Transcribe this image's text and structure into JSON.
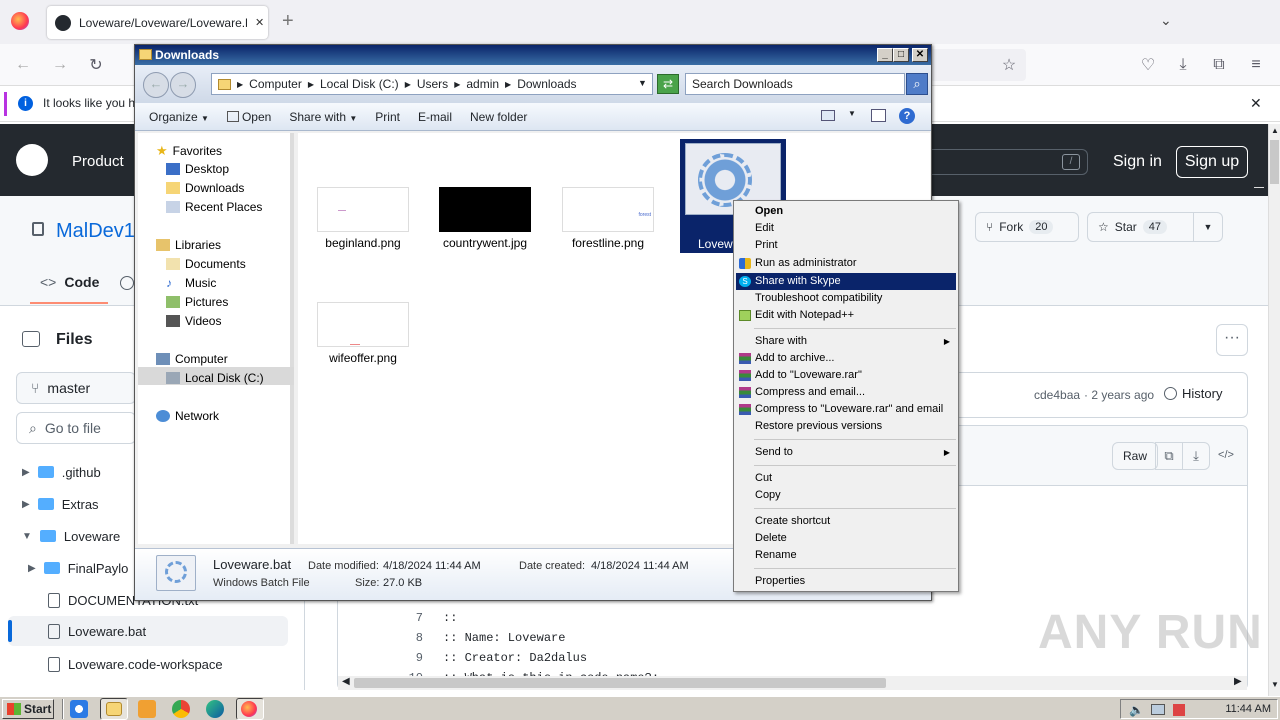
{
  "browser": {
    "tab_title": "Loveware/Loveware/Loveware.bat",
    "infobar_text": "It looks like you ha",
    "new_tab": "+",
    "close": "✕"
  },
  "github": {
    "nav_product": "Product",
    "sign_in": "Sign in",
    "sign_up": "Sign up",
    "repo_name": "MalDev1",
    "fork_label": "Fork",
    "fork_count": "20",
    "star_label": "Star",
    "star_count": "47",
    "tab_code": "Code",
    "files_title": "Files",
    "branch": "master",
    "goto_file": "Go to file",
    "commit_hash": "cde4baa",
    "commit_age": "· 2 years ago",
    "history": "History",
    "raw": "Raw",
    "tree": [
      {
        "label": ".github",
        "type": "folder"
      },
      {
        "label": "Extras",
        "type": "folder"
      },
      {
        "label": "Loveware",
        "type": "folder-open"
      },
      {
        "label": "FinalPaylo",
        "type": "folder"
      },
      {
        "label": "DOCUMENTATION.txt",
        "type": "file"
      },
      {
        "label": "Loveware.bat",
        "type": "file"
      },
      {
        "label": "Loveware.code-workspace",
        "type": "file"
      }
    ],
    "code_lines": [
      {
        "n": "7",
        "text": "::"
      },
      {
        "n": "8",
        "text": ":: Name: Loveware"
      },
      {
        "n": "9",
        "text": ":: Creator: Da2dalus"
      },
      {
        "n": "10",
        "text": ":: What is this in code name?:"
      }
    ]
  },
  "explorer": {
    "title": "Downloads",
    "breadcrumb": [
      "Computer",
      "Local Disk (C:)",
      "Users",
      "admin",
      "Downloads"
    ],
    "search_placeholder": "Search Downloads",
    "commands": [
      "Organize",
      "Open",
      "Share with",
      "Print",
      "E-mail",
      "New folder"
    ],
    "nav": {
      "favorites": "Favorites",
      "desktop": "Desktop",
      "downloads": "Downloads",
      "recent": "Recent Places",
      "libraries": "Libraries",
      "documents": "Documents",
      "music": "Music",
      "pictures": "Pictures",
      "videos": "Videos",
      "computer": "Computer",
      "local_disk": "Local Disk (C:)",
      "network": "Network"
    },
    "files": [
      {
        "name": "beginland.png"
      },
      {
        "name": "countrywent.jpg"
      },
      {
        "name": "forestline.png",
        "thumb_text": "forest"
      },
      {
        "name": "Loveware.bat",
        "display": "Lovewa"
      },
      {
        "name": "wifeoffer.png"
      }
    ],
    "details": {
      "name": "Loveware.bat",
      "type": "Windows Batch File",
      "modified_label": "Date modified:",
      "modified": "4/18/2024 11:44 AM",
      "created_label": "Date created:",
      "created": "4/18/2024 11:44 AM",
      "size_label": "Size:",
      "size": "27.0 KB"
    }
  },
  "context_menu": {
    "items": [
      "Open",
      "Edit",
      "Print",
      "Run as administrator",
      "Share with Skype",
      "Troubleshoot compatibility",
      "Edit with Notepad++",
      "Share with",
      "Add to archive...",
      "Add to \"Loveware.rar\"",
      "Compress and email...",
      "Compress to \"Loveware.rar\" and email",
      "Restore previous versions",
      "Send to",
      "Cut",
      "Copy",
      "Create shortcut",
      "Delete",
      "Rename",
      "Properties"
    ],
    "highlighted": "Share with Skype"
  },
  "taskbar": {
    "start": "Start",
    "clock": "11:44 AM"
  },
  "watermark": "ANY RUN",
  "colors": {
    "github_header": "#24292f",
    "explorer_title": "#0a246a",
    "menu_highlight": "#0a246a"
  }
}
